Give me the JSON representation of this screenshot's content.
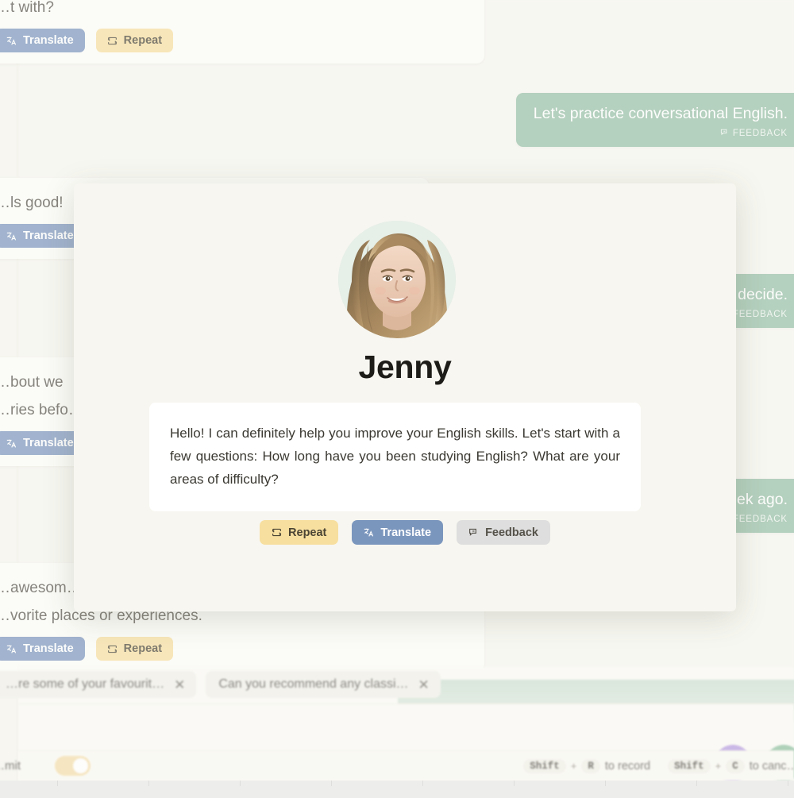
{
  "background_chat": {
    "agent_messages": [
      {
        "text": "…t with?",
        "actions": [
          {
            "label": "Translate",
            "icon": "translate-icon",
            "style": "translate"
          },
          {
            "label": "Repeat",
            "icon": "repeat-icon",
            "style": "repeat"
          }
        ]
      },
      {
        "text": "…ls good!",
        "actions": [
          {
            "label": "Translate",
            "icon": "translate-icon",
            "style": "translate"
          }
        ]
      },
      {
        "text": "…bout we",
        "text2": "…ries befo…",
        "actions": [
          {
            "label": "Translate",
            "icon": "translate-icon",
            "style": "translate"
          }
        ]
      },
      {
        "text": "…awesom…",
        "text2": "…vorite places or experiences.",
        "actions": [
          {
            "label": "Translate",
            "icon": "translate-icon",
            "style": "translate"
          },
          {
            "label": "Repeat",
            "icon": "repeat-icon",
            "style": "repeat"
          }
        ]
      }
    ],
    "user_messages": [
      {
        "text": "Let's practice conversational English.",
        "feedback_label": "FEEDBACK"
      },
      {
        "text": "…decide.",
        "feedback_label": "FEEDBACK"
      },
      {
        "text": "…ek ago.",
        "feedback_label": "FEEDBACK"
      }
    ]
  },
  "composer": {
    "suggestion_chips": [
      {
        "text": "…re some of your favourit…",
        "close": "✕"
      },
      {
        "text": "Can you recommend any classi…",
        "close": "✕"
      }
    ],
    "mic_icon": "microphone-icon",
    "send_icon": "send-icon"
  },
  "footer": {
    "auto_submit_label": "…mit",
    "toggle_state": "on",
    "shortcuts": [
      {
        "keys": [
          "Shift",
          "R"
        ],
        "separator": "+",
        "action": "to record"
      },
      {
        "keys": [
          "Shift",
          "C"
        ],
        "separator": "+",
        "action": "to canc…"
      }
    ]
  },
  "modal": {
    "avatar_name": "avatar",
    "name": "Jenny",
    "message": "Hello! I can definitely help you improve your English skills. Let's start with a few questions: How long have you been studying English? What are your areas of difficulty?",
    "actions": [
      {
        "label": "Repeat",
        "icon": "repeat-icon",
        "style": "repeat"
      },
      {
        "label": "Translate",
        "icon": "translate-icon",
        "style": "translate"
      },
      {
        "label": "Feedback",
        "icon": "feedback-icon",
        "style": "feedback"
      }
    ]
  },
  "colors": {
    "page_bg": "#f7f6f0",
    "agent_card": "#fcfcf8",
    "user_bubble": "#97bfa6",
    "translate": "#7b96bd",
    "repeat": "#f7dfa0",
    "feedback": "#dedede",
    "mic": "#b79ce0",
    "send": "#8fc0a0",
    "toggle_on": "#f4deab"
  }
}
